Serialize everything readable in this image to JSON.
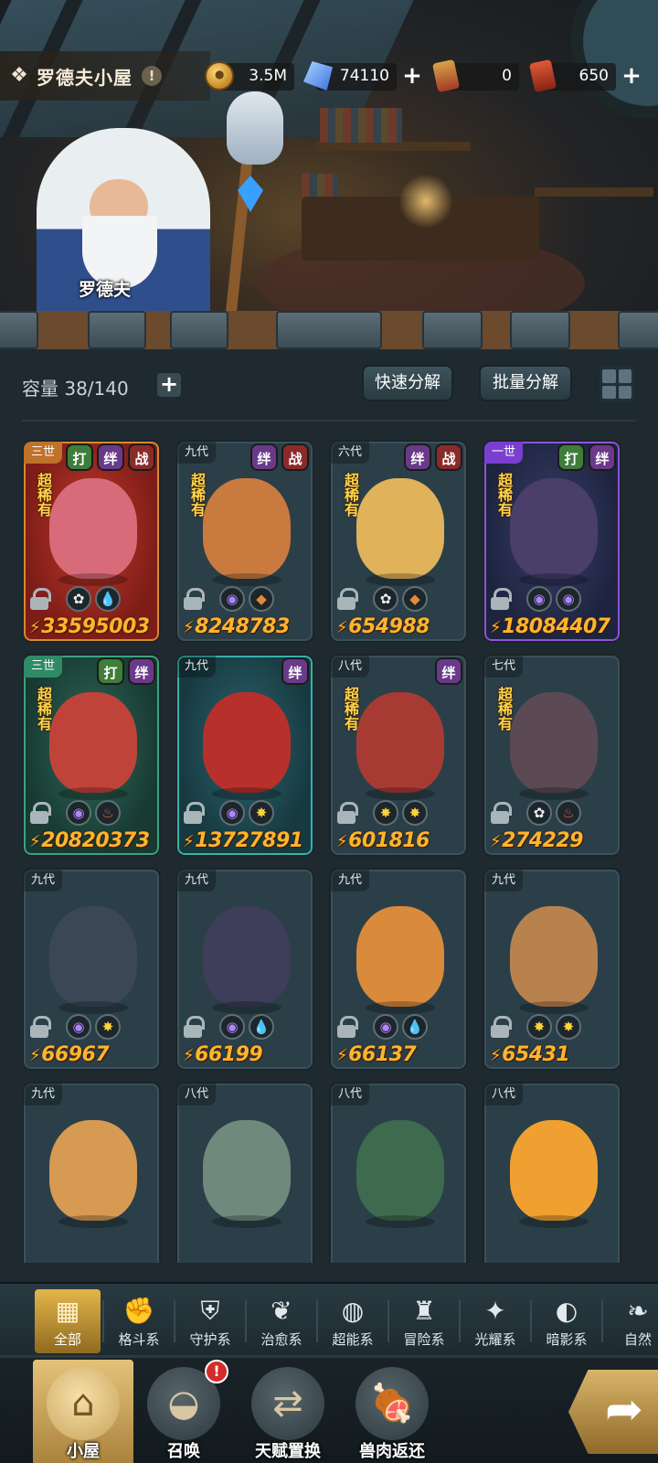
{
  "header": {
    "title": "罗德夫小屋",
    "info_symbol": "!",
    "resources": [
      {
        "name": "gold-coin",
        "value": "3.5M",
        "has_plus": false
      },
      {
        "name": "crystal",
        "value": "74110",
        "has_plus": true
      },
      {
        "name": "ticket-a",
        "value": "0",
        "has_plus": false
      },
      {
        "name": "ticket-b",
        "value": "650",
        "has_plus": true
      }
    ]
  },
  "scene": {
    "npc_name": "罗德夫"
  },
  "inventory": {
    "capacity_label": "容量 38/140",
    "quick_decompose": "快速分解",
    "batch_decompose": "批量分解"
  },
  "cards": [
    {
      "gen": "三世",
      "tags": [
        "打",
        "绊",
        "战"
      ],
      "rarity": "超稀有",
      "theme": "red",
      "body": "#d86b7a",
      "icons": [
        "plant",
        "water"
      ],
      "power": "33595003"
    },
    {
      "gen": "九代",
      "tags": [
        "绊",
        "战"
      ],
      "rarity": "超稀有",
      "theme": "",
      "body": "#c97a3f",
      "icons": [
        "dark",
        "earth"
      ],
      "power": "8248783"
    },
    {
      "gen": "六代",
      "tags": [
        "绊",
        "战"
      ],
      "rarity": "超稀有",
      "theme": "",
      "body": "#e0b25a",
      "icons": [
        "plant",
        "earth"
      ],
      "power": "654988"
    },
    {
      "gen": "一世",
      "tags": [
        "打",
        "绊"
      ],
      "rarity": "超稀有",
      "theme": "purple",
      "body": "#4a3e6a",
      "icons": [
        "dark",
        "dark"
      ],
      "power": "18084407"
    },
    {
      "gen": "三世",
      "tags": [
        "打",
        "绊"
      ],
      "rarity": "超稀有",
      "theme": "green",
      "body": "#c0433a",
      "icons": [
        "dark",
        "fire"
      ],
      "power": "20820373"
    },
    {
      "gen": "九代",
      "tags": [
        "绊"
      ],
      "rarity": "",
      "theme": "cyan",
      "body": "#b8302b",
      "icons": [
        "dark",
        "light"
      ],
      "power": "13727891"
    },
    {
      "gen": "八代",
      "tags": [
        "绊"
      ],
      "rarity": "超稀有",
      "theme": "",
      "body": "#a83a34",
      "icons": [
        "light",
        "light"
      ],
      "power": "601816"
    },
    {
      "gen": "七代",
      "tags": [],
      "rarity": "超稀有",
      "theme": "",
      "body": "#5b4a54",
      "icons": [
        "plant",
        "fire"
      ],
      "power": "274229"
    },
    {
      "gen": "九代",
      "tags": [],
      "rarity": "",
      "theme": "",
      "body": "#3c4756",
      "icons": [
        "dark",
        "light"
      ],
      "power": "66967"
    },
    {
      "gen": "九代",
      "tags": [],
      "rarity": "",
      "theme": "",
      "body": "#3e3e5a",
      "icons": [
        "dark",
        "water"
      ],
      "power": "66199"
    },
    {
      "gen": "九代",
      "tags": [],
      "rarity": "",
      "theme": "",
      "body": "#d98a3a",
      "icons": [
        "dark",
        "water"
      ],
      "power": "66137"
    },
    {
      "gen": "九代",
      "tags": [],
      "rarity": "",
      "theme": "",
      "body": "#b8824f",
      "icons": [
        "light",
        "light"
      ],
      "power": "65431"
    },
    {
      "gen": "九代",
      "tags": [],
      "rarity": "",
      "theme": "",
      "body": "#d69a52",
      "icons": [],
      "power": ""
    },
    {
      "gen": "八代",
      "tags": [],
      "rarity": "",
      "theme": "",
      "body": "#6f8a7d",
      "icons": [],
      "power": ""
    },
    {
      "gen": "八代",
      "tags": [],
      "rarity": "",
      "theme": "",
      "body": "#3e6a4e",
      "icons": [],
      "power": ""
    },
    {
      "gen": "八代",
      "tags": [],
      "rarity": "",
      "theme": "",
      "body": "#f0a030",
      "icons": [],
      "power": ""
    }
  ],
  "categories": [
    {
      "label": "全部",
      "icon": "all-icon",
      "active": true
    },
    {
      "label": "格斗系",
      "icon": "fist-icon",
      "active": false
    },
    {
      "label": "守护系",
      "icon": "shield-icon",
      "active": false
    },
    {
      "label": "治愈系",
      "icon": "sprout-icon",
      "active": false
    },
    {
      "label": "超能系",
      "icon": "psychic-icon",
      "active": false
    },
    {
      "label": "冒险系",
      "icon": "lantern-icon",
      "active": false
    },
    {
      "label": "光耀系",
      "icon": "star-icon",
      "active": false
    },
    {
      "label": "暗影系",
      "icon": "eye-icon",
      "active": false
    },
    {
      "label": "自然",
      "icon": "leaf-icon",
      "active": false
    }
  ],
  "nav": [
    {
      "label": "小屋",
      "icon": "hut-icon",
      "active": true,
      "alert": ""
    },
    {
      "label": "召唤",
      "icon": "egg-icon",
      "active": false,
      "alert": "!"
    },
    {
      "label": "天赋置换",
      "icon": "swap-icon",
      "active": false,
      "alert": ""
    },
    {
      "label": "兽肉返还",
      "icon": "meat-icon",
      "active": false,
      "alert": ""
    }
  ]
}
